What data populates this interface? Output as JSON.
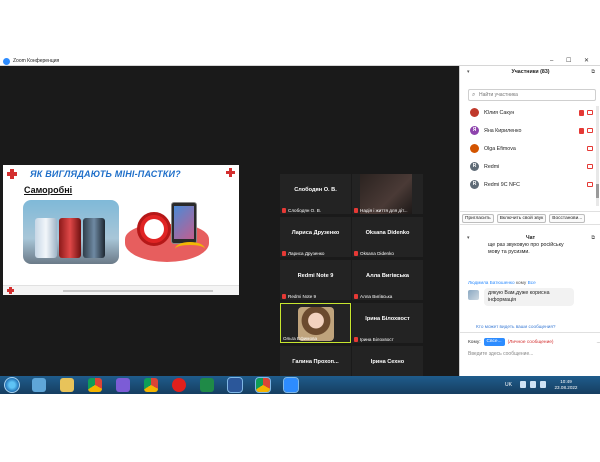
{
  "window": {
    "title": "Zoom Конференция",
    "controls": [
      "–",
      "☐",
      "✕"
    ]
  },
  "slide": {
    "title": "ЯК ВИГЛЯДАЮТЬ МІНІ-ПАСТКИ?",
    "subtitle": "Саморобні"
  },
  "tiles": [
    {
      "name": "Слободян О. В.",
      "label": "Слободян О. В."
    },
    {
      "name": "",
      "label": "Надія і життя для діт..."
    },
    {
      "name": "Лариса Друзенко",
      "label": "Лариса Друзенко"
    },
    {
      "name": "Oksana Didenko",
      "label": "Oksana Didenko"
    },
    {
      "name": "Redmi Note 9",
      "label": "Redmi Note 9"
    },
    {
      "name": "Алла Вигівська",
      "label": "Алла Вигівська"
    },
    {
      "name": "",
      "label": "Ольга Ефимова"
    },
    {
      "name": "Ірина Білохвост",
      "label": "Ірина Білохвост"
    },
    {
      "name": "Галина Прохоп...",
      "label": "Галина Прохопенко"
    },
    {
      "name": "Ірина Сехно",
      "label": "Ірина Сехно"
    }
  ],
  "participants": {
    "header": "Участники (83)",
    "search_placeholder": "Найти участника",
    "list": [
      {
        "initial": "",
        "name": "Юлия Сакун",
        "color": "#c0392b"
      },
      {
        "initial": "Я",
        "name": "Яна Кириленко",
        "color": "#8e44ad"
      },
      {
        "initial": "",
        "name": "Olga Efimova",
        "color": "#d35400"
      },
      {
        "initial": "R",
        "name": "Redmi",
        "color": "#5f6b76"
      },
      {
        "initial": "R",
        "name": "Redmi 9C NFC",
        "color": "#5f6b76"
      }
    ],
    "buttons": [
      "Пригласить",
      "Включить свой звук",
      "Восстанови..."
    ]
  },
  "chat": {
    "header": "Чат",
    "msg1": "ще раз звуковую про російську мову та русизми.",
    "sender_name": "Людмила Батюшенко",
    "sender_to": "кому",
    "sender_target": "Все",
    "msg2": "дякую Вам,дуже корисна інформація",
    "who_sees": "Кто может видеть ваши сообщения?",
    "to_label": "Кому:",
    "to_value": "Свсе...",
    "private_label": "(Личное сообщение)",
    "more": "...",
    "input_placeholder": "Введите здесь сообщение..."
  },
  "taskbar": {
    "lang": "UK",
    "time": "10:49",
    "date": "23.08.2022"
  }
}
